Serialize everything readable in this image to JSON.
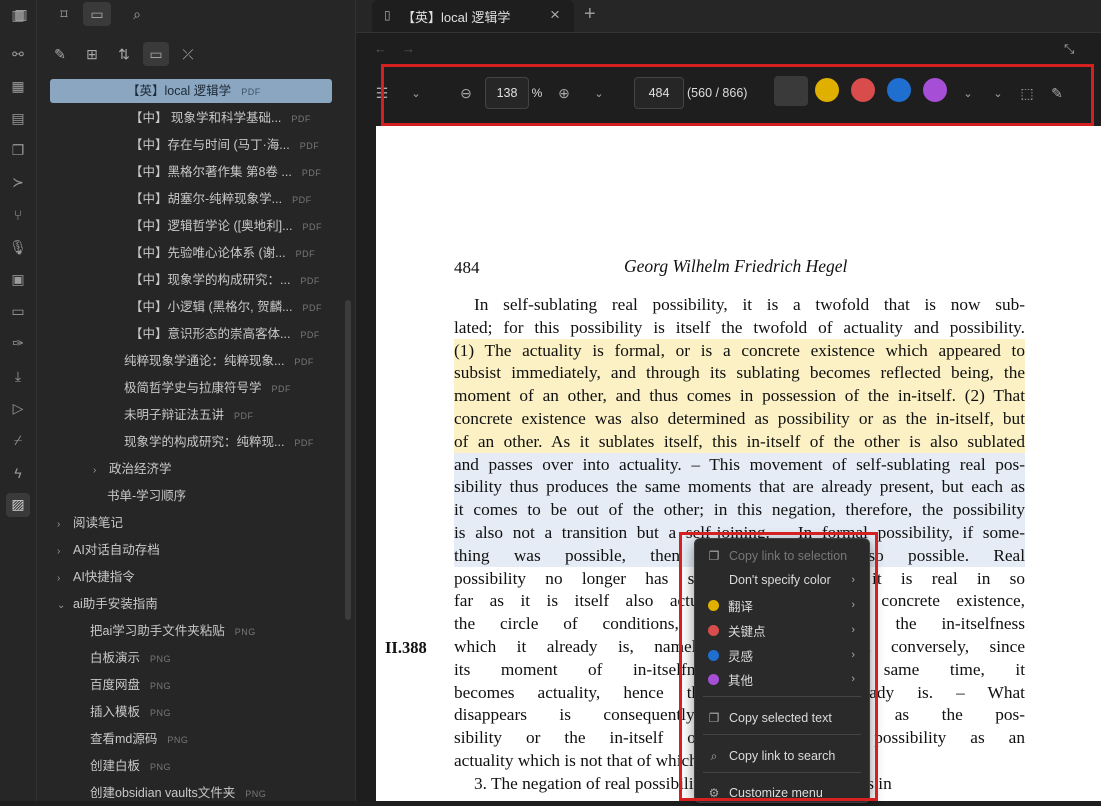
{
  "ribbon": {
    "icons": [
      "sidebar-toggle-icon",
      "graph-icon",
      "grid-icon",
      "calendar-icon",
      "copy-icon",
      "terminal-icon",
      "git-icon",
      "microphone-icon",
      "layout-icon",
      "comment-icon",
      "brush-icon",
      "download-icon",
      "play-icon",
      "broom-icon",
      "lightning-icon",
      "clipboard-icon"
    ]
  },
  "left_panel": {
    "top_icons": [
      "sidebar-icon",
      "bookmark-icon",
      "folder-icon",
      "search-icon"
    ],
    "nav_icons": [
      "new-note-icon",
      "new-folder-icon",
      "sort-icon",
      "collapse-view-icon",
      "collapse-all-icon"
    ],
    "tree": [
      {
        "label": "【英】local 逻辑学",
        "ext": "PDF",
        "active": true
      },
      {
        "label": "【中】 现象学和科学基础...",
        "ext": "PDF"
      },
      {
        "label": "【中】存在与时间 (马丁·海...",
        "ext": "PDF"
      },
      {
        "label": "【中】黑格尔著作集 第8卷 ...",
        "ext": "PDF"
      },
      {
        "label": "【中】胡塞尔-纯粹现象学...",
        "ext": "PDF"
      },
      {
        "label": "【中】逻辑哲学论 ([奥地利]...",
        "ext": "PDF"
      },
      {
        "label": "【中】先验唯心论体系 (谢...",
        "ext": "PDF"
      },
      {
        "label": "【中】现象学的构成研究：...",
        "ext": "PDF"
      },
      {
        "label": "【中】小逻辑 (黑格尔, 贺麟...",
        "ext": "PDF"
      },
      {
        "label": "【中】意识形态的崇高客体...",
        "ext": "PDF"
      },
      {
        "label": "纯粹现象学通论：纯粹现象...",
        "ext": "PDF"
      },
      {
        "label": "极简哲学史与拉康符号学",
        "ext": "PDF"
      },
      {
        "label": "未明子辩证法五讲",
        "ext": "PDF"
      },
      {
        "label": "现象学的构成研究：纯粹现...",
        "ext": "PDF"
      },
      {
        "label": "政治经济学",
        "ext": "",
        "folder": true
      },
      {
        "label": "书单-学习顺序",
        "ext": ""
      },
      {
        "label": "阅读笔记",
        "ext": "",
        "folder": true
      },
      {
        "label": "AI对话自动存档",
        "ext": "",
        "folder": true
      },
      {
        "label": "AI快捷指令",
        "ext": "",
        "folder": true
      },
      {
        "label": "ai助手安装指南",
        "ext": "",
        "folder": true,
        "open": true
      },
      {
        "label": "把ai学习助手文件夹粘贴",
        "ext": "PNG"
      },
      {
        "label": "白板演示",
        "ext": "PNG"
      },
      {
        "label": "百度网盘",
        "ext": "PNG"
      },
      {
        "label": "插入模板",
        "ext": "PNG"
      },
      {
        "label": "查看md源码",
        "ext": "PNG"
      },
      {
        "label": "创建白板",
        "ext": "PNG"
      },
      {
        "label": "创建obsidian vaults文件夹",
        "ext": "PNG"
      }
    ]
  },
  "tab": {
    "title": "【英】local 逻辑学",
    "close": "×",
    "new": "+"
  },
  "toolbar": {
    "zoom": "138",
    "percent": "%",
    "page": "484",
    "page_info": "(560 / 866)",
    "colors": [
      "#3a3a3a",
      "#e0b000",
      "#d94c4c",
      "#1f6fd1",
      "#a64fd6"
    ]
  },
  "document": {
    "page_number": "484",
    "running_head": "Georg Wilhelm Friedrich Hegel",
    "margin_ref": "II.388",
    "lines": [
      {
        "t": "In self-sublating real possibility, it is a twofold that is now sub-",
        "indent": true
      },
      {
        "t": "lated; for this possibility is itself the twofold of actuality and possibility."
      },
      {
        "t": "(1) The actuality is formal, or is a concrete existence which appeared to",
        "hl": "y"
      },
      {
        "t": "subsist immediately, and through its sublating becomes reflected being, the",
        "hl": "y"
      },
      {
        "t": "moment of an other, and thus comes in possession of the in-itself. (2) That",
        "hl": "y"
      },
      {
        "t": "concrete existence was also determined as possibility or as the in-itself, but",
        "hl": "y"
      },
      {
        "t": "of an other. As it sublates itself, this in-itself of the other is also sublated",
        "hl": "y"
      },
      {
        "t": "and passes over into actuality. – This movement of self-sublating real pos-",
        "hl": "b"
      },
      {
        "t": "sibility thus produces the same moments that are already present, but each as",
        "hl": "b"
      },
      {
        "t": "it comes to be out of the other; in this negation, therefore, the possibility",
        "hl": "b"
      },
      {
        "t": "is also not a transition but a self-joining. – In formal possibility, if some-",
        "hl": "b"
      },
      {
        "t": "thing was possible, then an other was also possible. Real",
        "hl": "b"
      },
      {
        "t": "possibility no longer has such an other, for it is real in so"
      },
      {
        "t": "far as it is itself also actuality. The immediate concrete existence,"
      },
      {
        "t": "the circle of conditions, sublates itself into the in-itselfness"
      },
      {
        "t": "which it already is, namely the in-itself, and conversely, since"
      },
      {
        "t": "its moment of in-itselfness is at the same time, it"
      },
      {
        "t": "becomes actuality, hence the moment it already is. – What"
      },
      {
        "t": "disappears is consequently this determined as the pos-"
      },
      {
        "t": "sibility or the in-itself of an other, the possibility as an"
      },
      {
        "t": "actuality which is not that of which it is."
      },
      {
        "t": "3. The negation of real possibility is identity; inasmuch as in",
        "indent": true
      }
    ]
  },
  "context_menu": {
    "items": [
      {
        "label": "Copy link to selection",
        "icon": "copy-link-icon",
        "disabled": true
      },
      {
        "label": "Don't specify color",
        "arrow": true
      },
      {
        "label": "翻译",
        "dot": "#e0b000",
        "arrow": true
      },
      {
        "label": "关键点",
        "dot": "#d94c4c",
        "arrow": true
      },
      {
        "label": "灵感",
        "dot": "#1f6fd1",
        "arrow": true
      },
      {
        "label": "其他",
        "dot": "#a64fd6",
        "arrow": true
      },
      {
        "label": "Copy selected text",
        "icon": "copy-icon"
      },
      {
        "label": "Copy link to search",
        "icon": "search-icon"
      },
      {
        "label": "Customize menu",
        "icon": "gear-icon"
      }
    ]
  }
}
